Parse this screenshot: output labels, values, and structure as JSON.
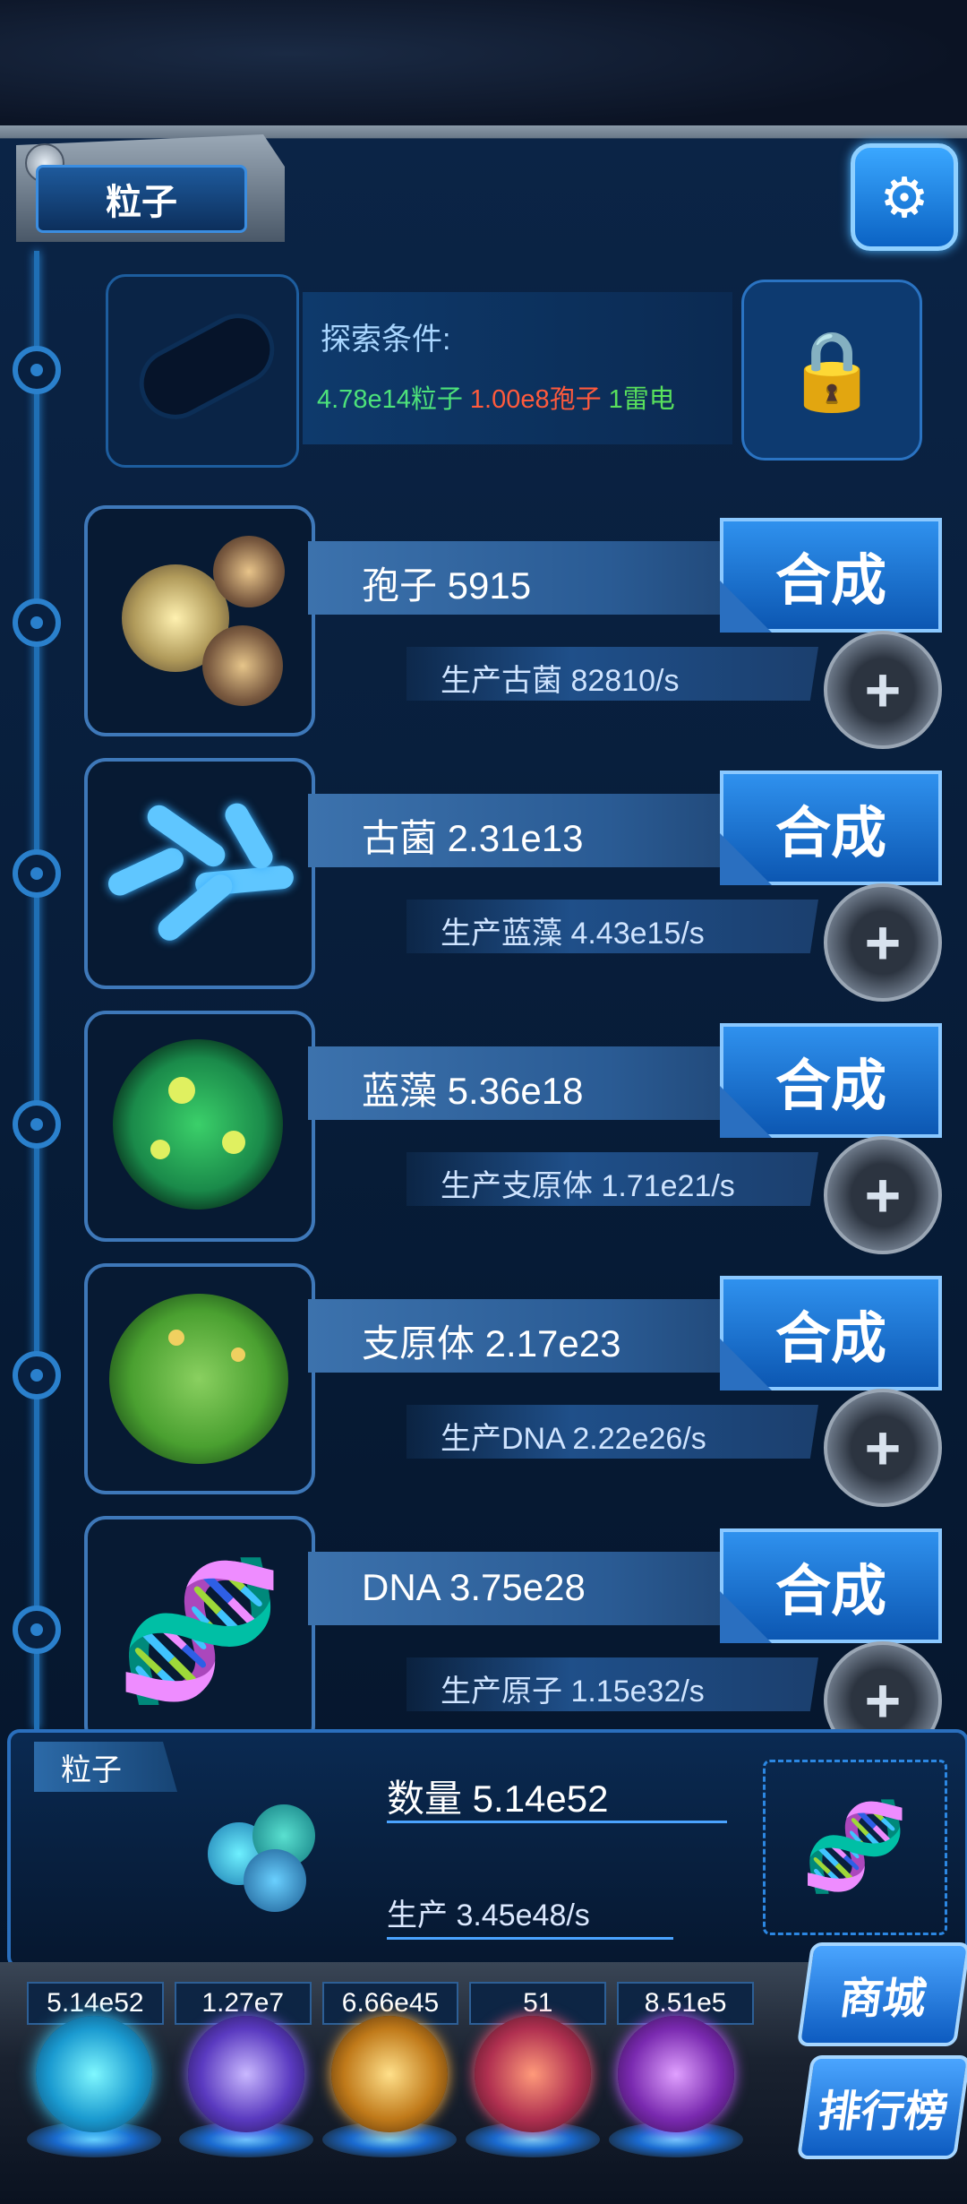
{
  "header": {
    "title": "粒子"
  },
  "explore": {
    "label": "探索条件:",
    "cond_particles": "4.78e14粒子",
    "cond_spores": "1.00e8孢子",
    "cond_thunder": "1雷电"
  },
  "rows": [
    {
      "name": "孢子 5915",
      "rate": "生产古菌 82810/s",
      "synth": "合成"
    },
    {
      "name": "古菌 2.31e13",
      "rate": "生产蓝藻 4.43e15/s",
      "synth": "合成"
    },
    {
      "name": "蓝藻 5.36e18",
      "rate": "生产支原体 1.71e21/s",
      "synth": "合成"
    },
    {
      "name": "支原体 2.17e23",
      "rate": "生产DNA 2.22e26/s",
      "synth": "合成"
    },
    {
      "name": "DNA 3.75e28",
      "rate": "生产原子 1.15e32/s",
      "synth": "合成"
    }
  ],
  "summary": {
    "tag": "粒子",
    "count": "数量 5.14e52",
    "production": "生产 3.45e48/s"
  },
  "stats": [
    "5.14e52",
    "1.27e7",
    "6.66e45",
    "51",
    "8.51e5"
  ],
  "side_buttons": {
    "shop": "商城",
    "rank": "排行榜"
  },
  "colors": {
    "accent": "#2f91ee",
    "cond_green": "#4de27a",
    "cond_red": "#ff5a3c"
  }
}
